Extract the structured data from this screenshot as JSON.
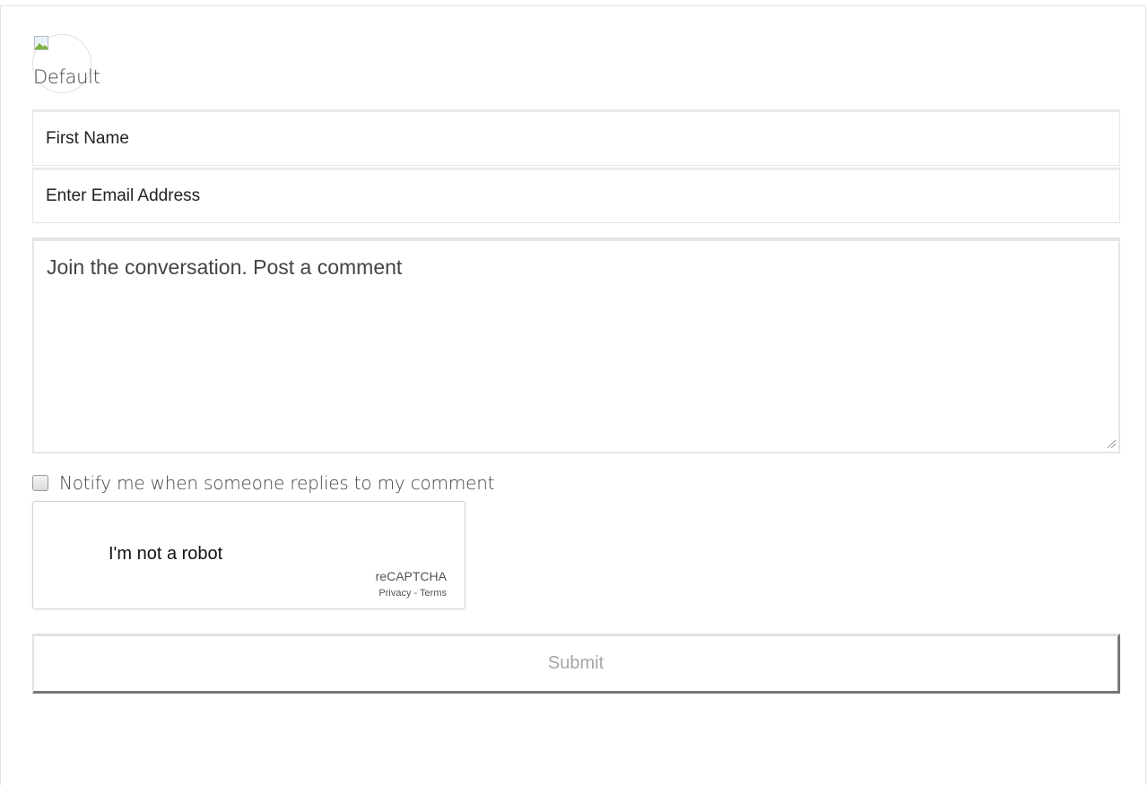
{
  "avatar": {
    "label": "Default"
  },
  "form": {
    "first_name_placeholder": "First Name",
    "email_placeholder": "Enter Email Address",
    "comment_placeholder": "Join the conversation. Post a comment",
    "notify_label": "Notify me when someone replies to my comment",
    "submit_label": "Submit"
  },
  "recaptcha": {
    "label": "I'm not a robot",
    "brand": "reCAPTCHA",
    "privacy": "Privacy",
    "separator": " - ",
    "terms": "Terms"
  }
}
